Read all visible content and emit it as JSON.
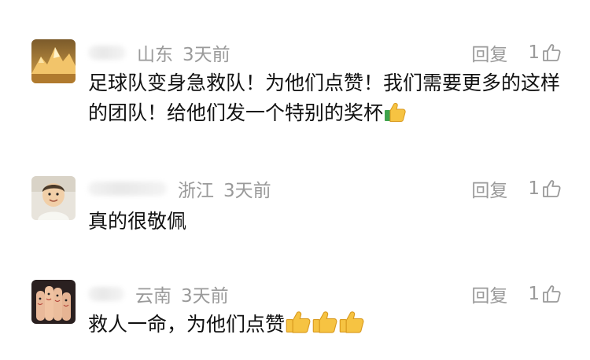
{
  "comments": [
    {
      "name_visible": "",
      "region": "山东",
      "time": "3天前",
      "reply_label": "回复",
      "like_count": "1",
      "text": "足球队变身急救队！为他们点赞！我们需要更多的这样的团队！给他们发一个特别的奖杯",
      "trailing_emojis": [
        "thumbs-up-icon"
      ]
    },
    {
      "name_visible": "",
      "region": "浙江",
      "time": "3天前",
      "reply_label": "回复",
      "like_count": "1",
      "text": "真的很敬佩",
      "trailing_emojis": []
    },
    {
      "name_visible": "",
      "region": "云南",
      "time": "3天前",
      "reply_label": "回复",
      "like_count": "1",
      "text": "救人一命，为他们点赞",
      "trailing_emojis": [
        "thumbs-up-icon",
        "thumbs-up-icon",
        "thumbs-up-icon"
      ]
    }
  ],
  "colors": {
    "meta_text": "#9a9a9a",
    "body_text": "#111111",
    "thumb_yellow": "#f6c342"
  }
}
